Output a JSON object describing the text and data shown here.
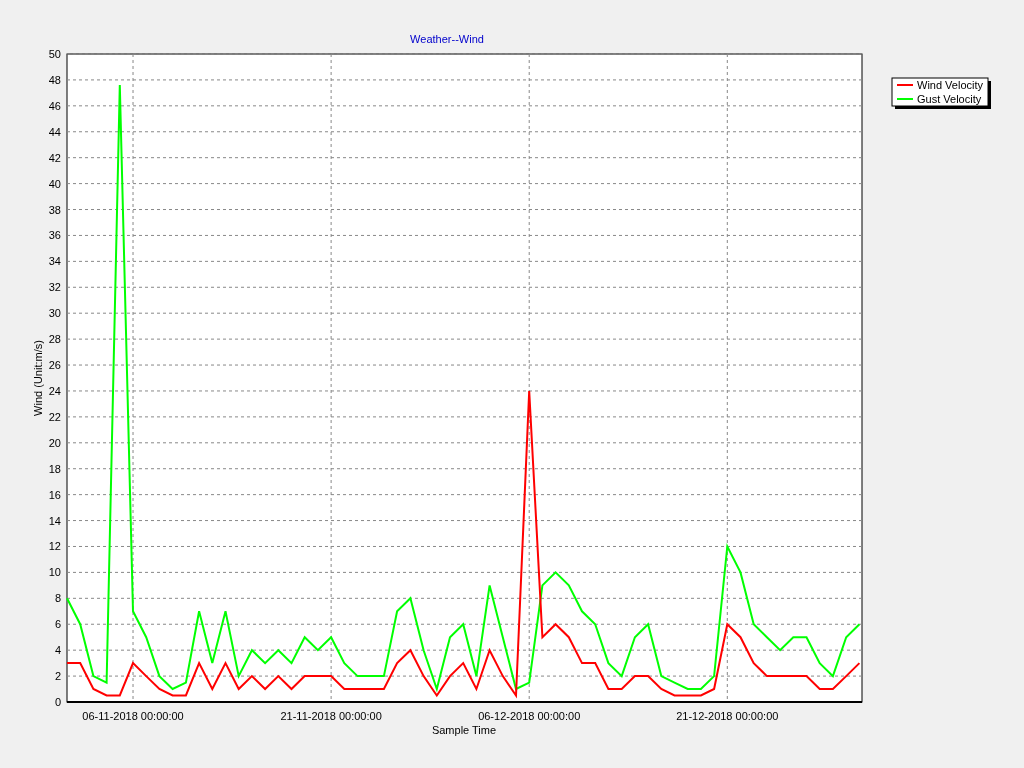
{
  "chart_data": {
    "type": "line",
    "title": "Weather--Wind",
    "xlabel": "Sample Time",
    "ylabel": "Wind (Unit:m/s)",
    "categories": [
      null,
      null,
      null,
      null,
      null,
      "06-11-2018 00:00:00",
      null,
      null,
      null,
      null,
      null,
      null,
      null,
      null,
      null,
      null,
      null,
      null,
      null,
      null,
      "21-11-2018 00:00:00",
      null,
      null,
      null,
      null,
      null,
      null,
      null,
      null,
      null,
      null,
      null,
      null,
      null,
      null,
      "06-12-2018 00:00:00",
      null,
      null,
      null,
      null,
      null,
      null,
      null,
      null,
      null,
      null,
      null,
      null,
      null,
      null,
      "21-12-2018 00:00:00",
      null,
      null,
      null,
      null,
      null,
      null,
      null,
      null,
      null,
      null
    ],
    "ylim": [
      0,
      50
    ],
    "grid": true,
    "legend": true,
    "yticks": [
      0,
      2,
      4,
      6,
      8,
      10,
      12,
      14,
      16,
      18,
      20,
      22,
      24,
      26,
      28,
      30,
      32,
      34,
      36,
      38,
      40,
      42,
      44,
      46,
      48,
      50
    ],
    "series": [
      {
        "name": "Wind Velocity",
        "color": "#ff0000",
        "values": [
          3,
          3,
          1,
          0.5,
          0.5,
          3,
          2,
          1,
          0.5,
          0.5,
          3,
          1,
          3,
          1,
          2,
          1,
          2,
          1,
          2,
          2,
          2,
          1,
          1,
          1,
          1,
          3,
          4,
          2,
          0.5,
          2,
          3,
          1,
          4,
          2,
          0.5,
          24,
          5,
          6,
          5,
          3,
          3,
          1,
          1,
          2,
          2,
          1,
          0.5,
          0.5,
          0.5,
          1,
          6,
          5,
          3,
          2,
          2,
          2,
          2,
          1,
          1,
          2,
          3
        ]
      },
      {
        "name": "Gust Velocity",
        "color": "#00ff00",
        "values": [
          8,
          6,
          2,
          1.5,
          47.6,
          7,
          5,
          2,
          1,
          1.5,
          7,
          3,
          7,
          2,
          4,
          3,
          4,
          3,
          5,
          4,
          5,
          3,
          2,
          2,
          2,
          7,
          8,
          4,
          1,
          5,
          6,
          2,
          9,
          5,
          1,
          1.5,
          9,
          10,
          9,
          7,
          6,
          3,
          2,
          5,
          6,
          2,
          1.5,
          1,
          1,
          2,
          12,
          10,
          6,
          5,
          4,
          5,
          5,
          3,
          2,
          5,
          6
        ]
      }
    ]
  }
}
